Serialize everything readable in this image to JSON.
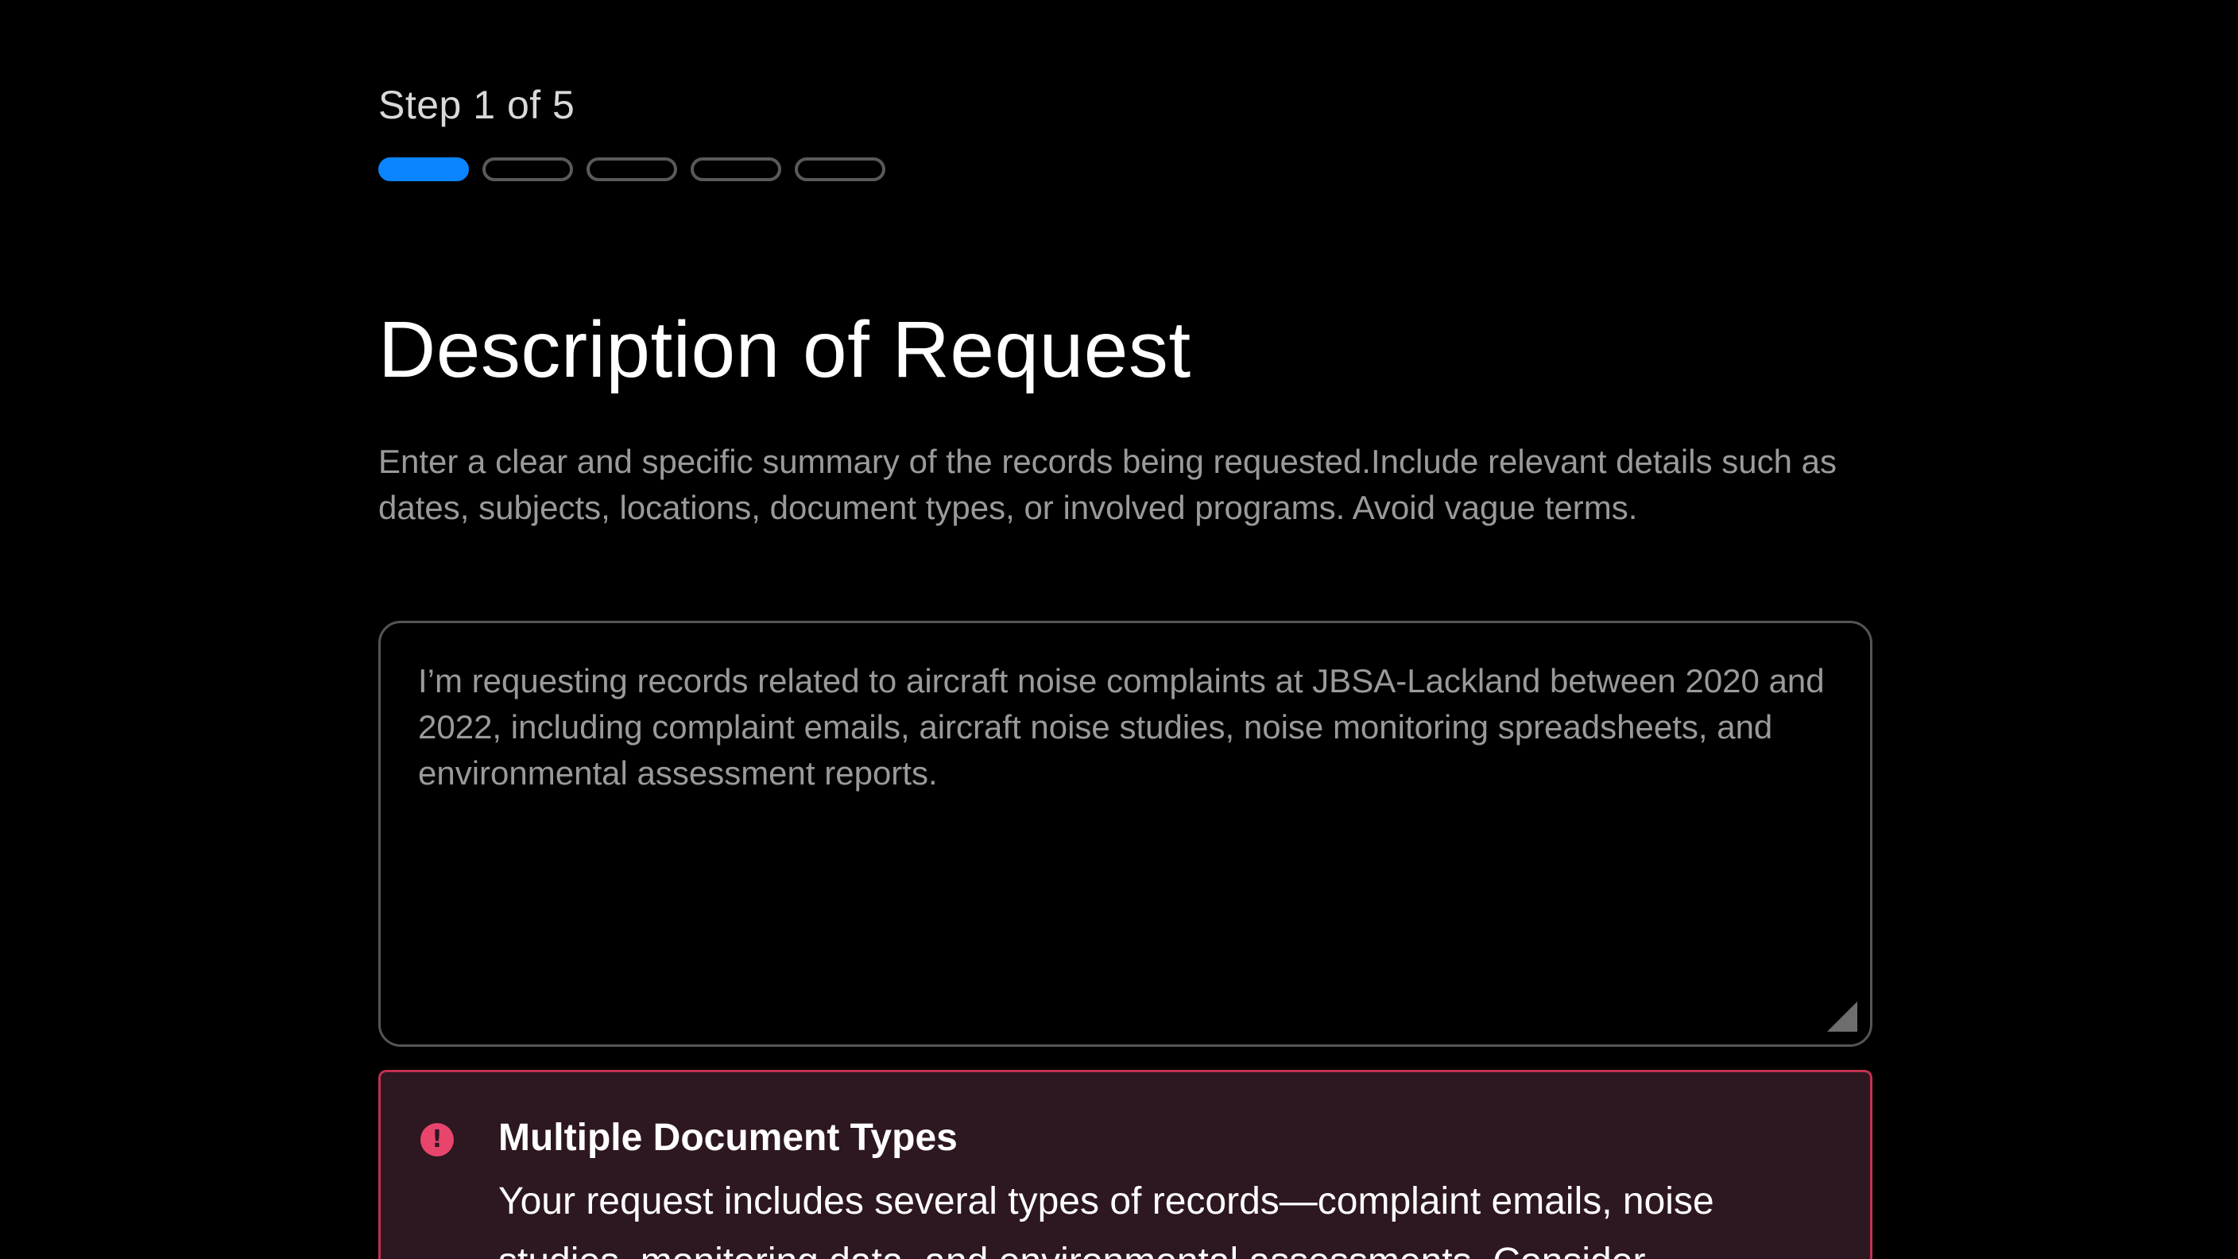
{
  "stepper": {
    "label": "Step 1 of 5",
    "total_steps": 5,
    "current_step": 1,
    "active_color": "#0a84ff"
  },
  "page": {
    "title": "Description of Request",
    "description": "Enter a clear and specific summary of the records being requested.Include relevant details such as dates, subjects, locations, document types, or involved programs. Avoid vague terms."
  },
  "request_field": {
    "value": "I’m requesting records related to aircraft noise complaints at JBSA-Lackland between 2020 and 2022, including complaint emails, aircraft noise studies, noise monitoring spreadsheets, and environmental assessment reports."
  },
  "alert": {
    "icon": "exclamation-circle-icon",
    "color": "#e8456d",
    "title": "Multiple Document Types",
    "body": "Your request includes several types of records—complaint emails, noise studies, monitoring data, and environmental assessments. Consider"
  }
}
